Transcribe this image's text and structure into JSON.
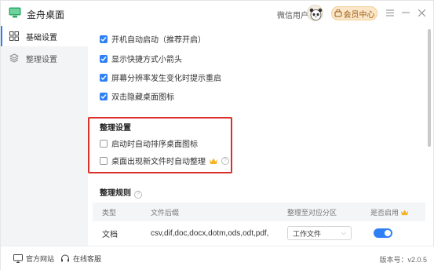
{
  "app": {
    "title": "金舟桌面"
  },
  "header": {
    "user_name": "微信用户",
    "vip_label": "会员中心"
  },
  "sidebar": {
    "items": [
      {
        "label": "基础设置",
        "active": true,
        "icon": "grid-icon"
      },
      {
        "label": "整理设置",
        "active": false,
        "icon": "layers-icon"
      }
    ]
  },
  "basic_settings": [
    {
      "label": "开机自动启动（推荐开启）",
      "checked": true
    },
    {
      "label": "显示快捷方式小箭头",
      "checked": true
    },
    {
      "label": "屏幕分辨率发生变化时提示重启",
      "checked": true
    },
    {
      "label": "双击隐藏桌面图标",
      "checked": true
    }
  ],
  "organize": {
    "title": "整理设置",
    "options": [
      {
        "label": "启动时自动排序桌面图标",
        "checked": false
      },
      {
        "label": "桌面出现新文件时自动整理",
        "checked": false,
        "vip": true
      }
    ]
  },
  "rules": {
    "title": "整理规则",
    "columns": [
      "类型",
      "文件后缀",
      "整理至对应分区",
      "是否启用"
    ],
    "rows": [
      {
        "type": "文档",
        "suffix": "csv,dif,doc,docx,dotm,ods,odt,pdf,pc",
        "target": "工作文件",
        "enabled": true
      }
    ]
  },
  "footer": {
    "website": "官方网站",
    "support": "在线客服",
    "version": "版本号：v2.0.5"
  },
  "colors": {
    "accent": "#2f80f6",
    "highlight": "#d9312a",
    "vip": "#fbe7c8"
  }
}
